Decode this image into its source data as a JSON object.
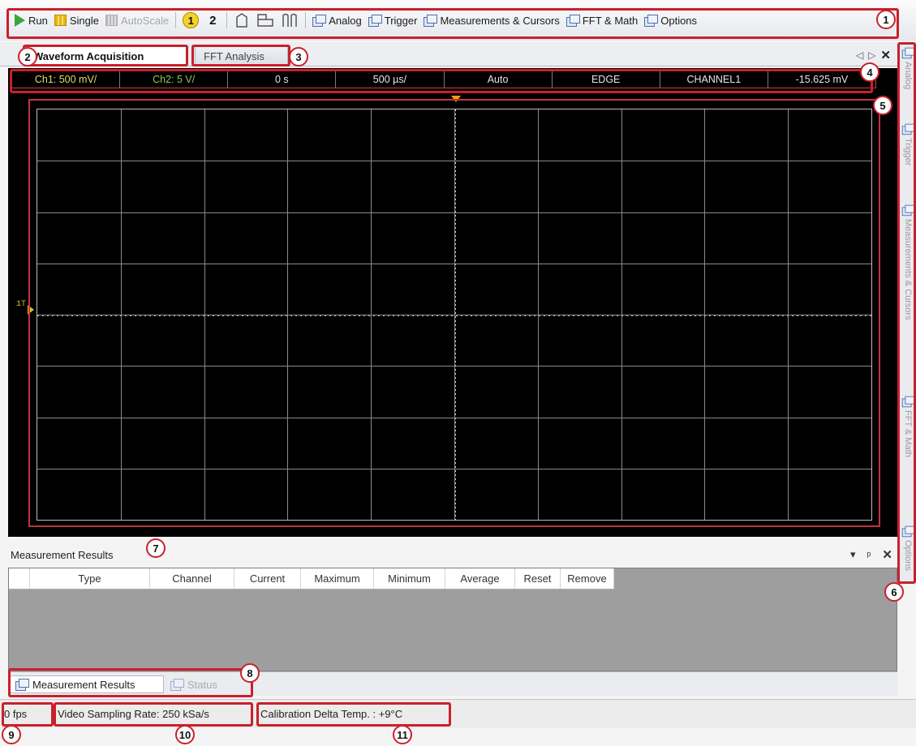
{
  "toolbar": {
    "run": "Run",
    "single": "Single",
    "autoscale": "AutoScale",
    "ch1": "1",
    "ch2": "2",
    "analog": "Analog",
    "trigger": "Trigger",
    "measurements": "Measurements & Cursors",
    "fft_math": "FFT & Math",
    "options": "Options"
  },
  "tabs": {
    "waveform": "Waveform Acquisition",
    "fft": "FFT Analysis",
    "nav_left": "◁",
    "nav_right": "▷",
    "close": "✕"
  },
  "scope_status": [
    "Ch1: 500 mV/",
    "Ch2: 5 V/",
    "0 s",
    "500 µs/",
    "Auto",
    "EDGE",
    "CHANNEL1",
    "-15.625 mV"
  ],
  "scope": {
    "channel_marker": "1T"
  },
  "right_rail": [
    "Analog",
    "Trigger",
    "Measurements & Cursors",
    "FFT & Math",
    "Options"
  ],
  "measurement": {
    "title": "Measurement Results",
    "pin": "▾",
    "dock": "ᵖ",
    "close": "✕",
    "columns": [
      "",
      "Type",
      "Channel",
      "Current",
      "Maximum",
      "Minimum",
      "Average",
      "Reset",
      "Remove"
    ]
  },
  "bottom_tabs": {
    "results": "Measurement Results",
    "status": "Status"
  },
  "statusbar": {
    "fps": "0   fps",
    "rate": "Video Sampling Rate:   250 kSa/s",
    "temp": "Calibration Delta Temp. :   +9°C"
  },
  "callouts": [
    "1",
    "2",
    "3",
    "4",
    "5",
    "6",
    "7",
    "8",
    "9",
    "10",
    "11"
  ],
  "colors": {
    "callout": "#c9202c",
    "ch1": "#e9d86b",
    "ch2": "#8ec95a",
    "trigger": "#f0a000"
  }
}
